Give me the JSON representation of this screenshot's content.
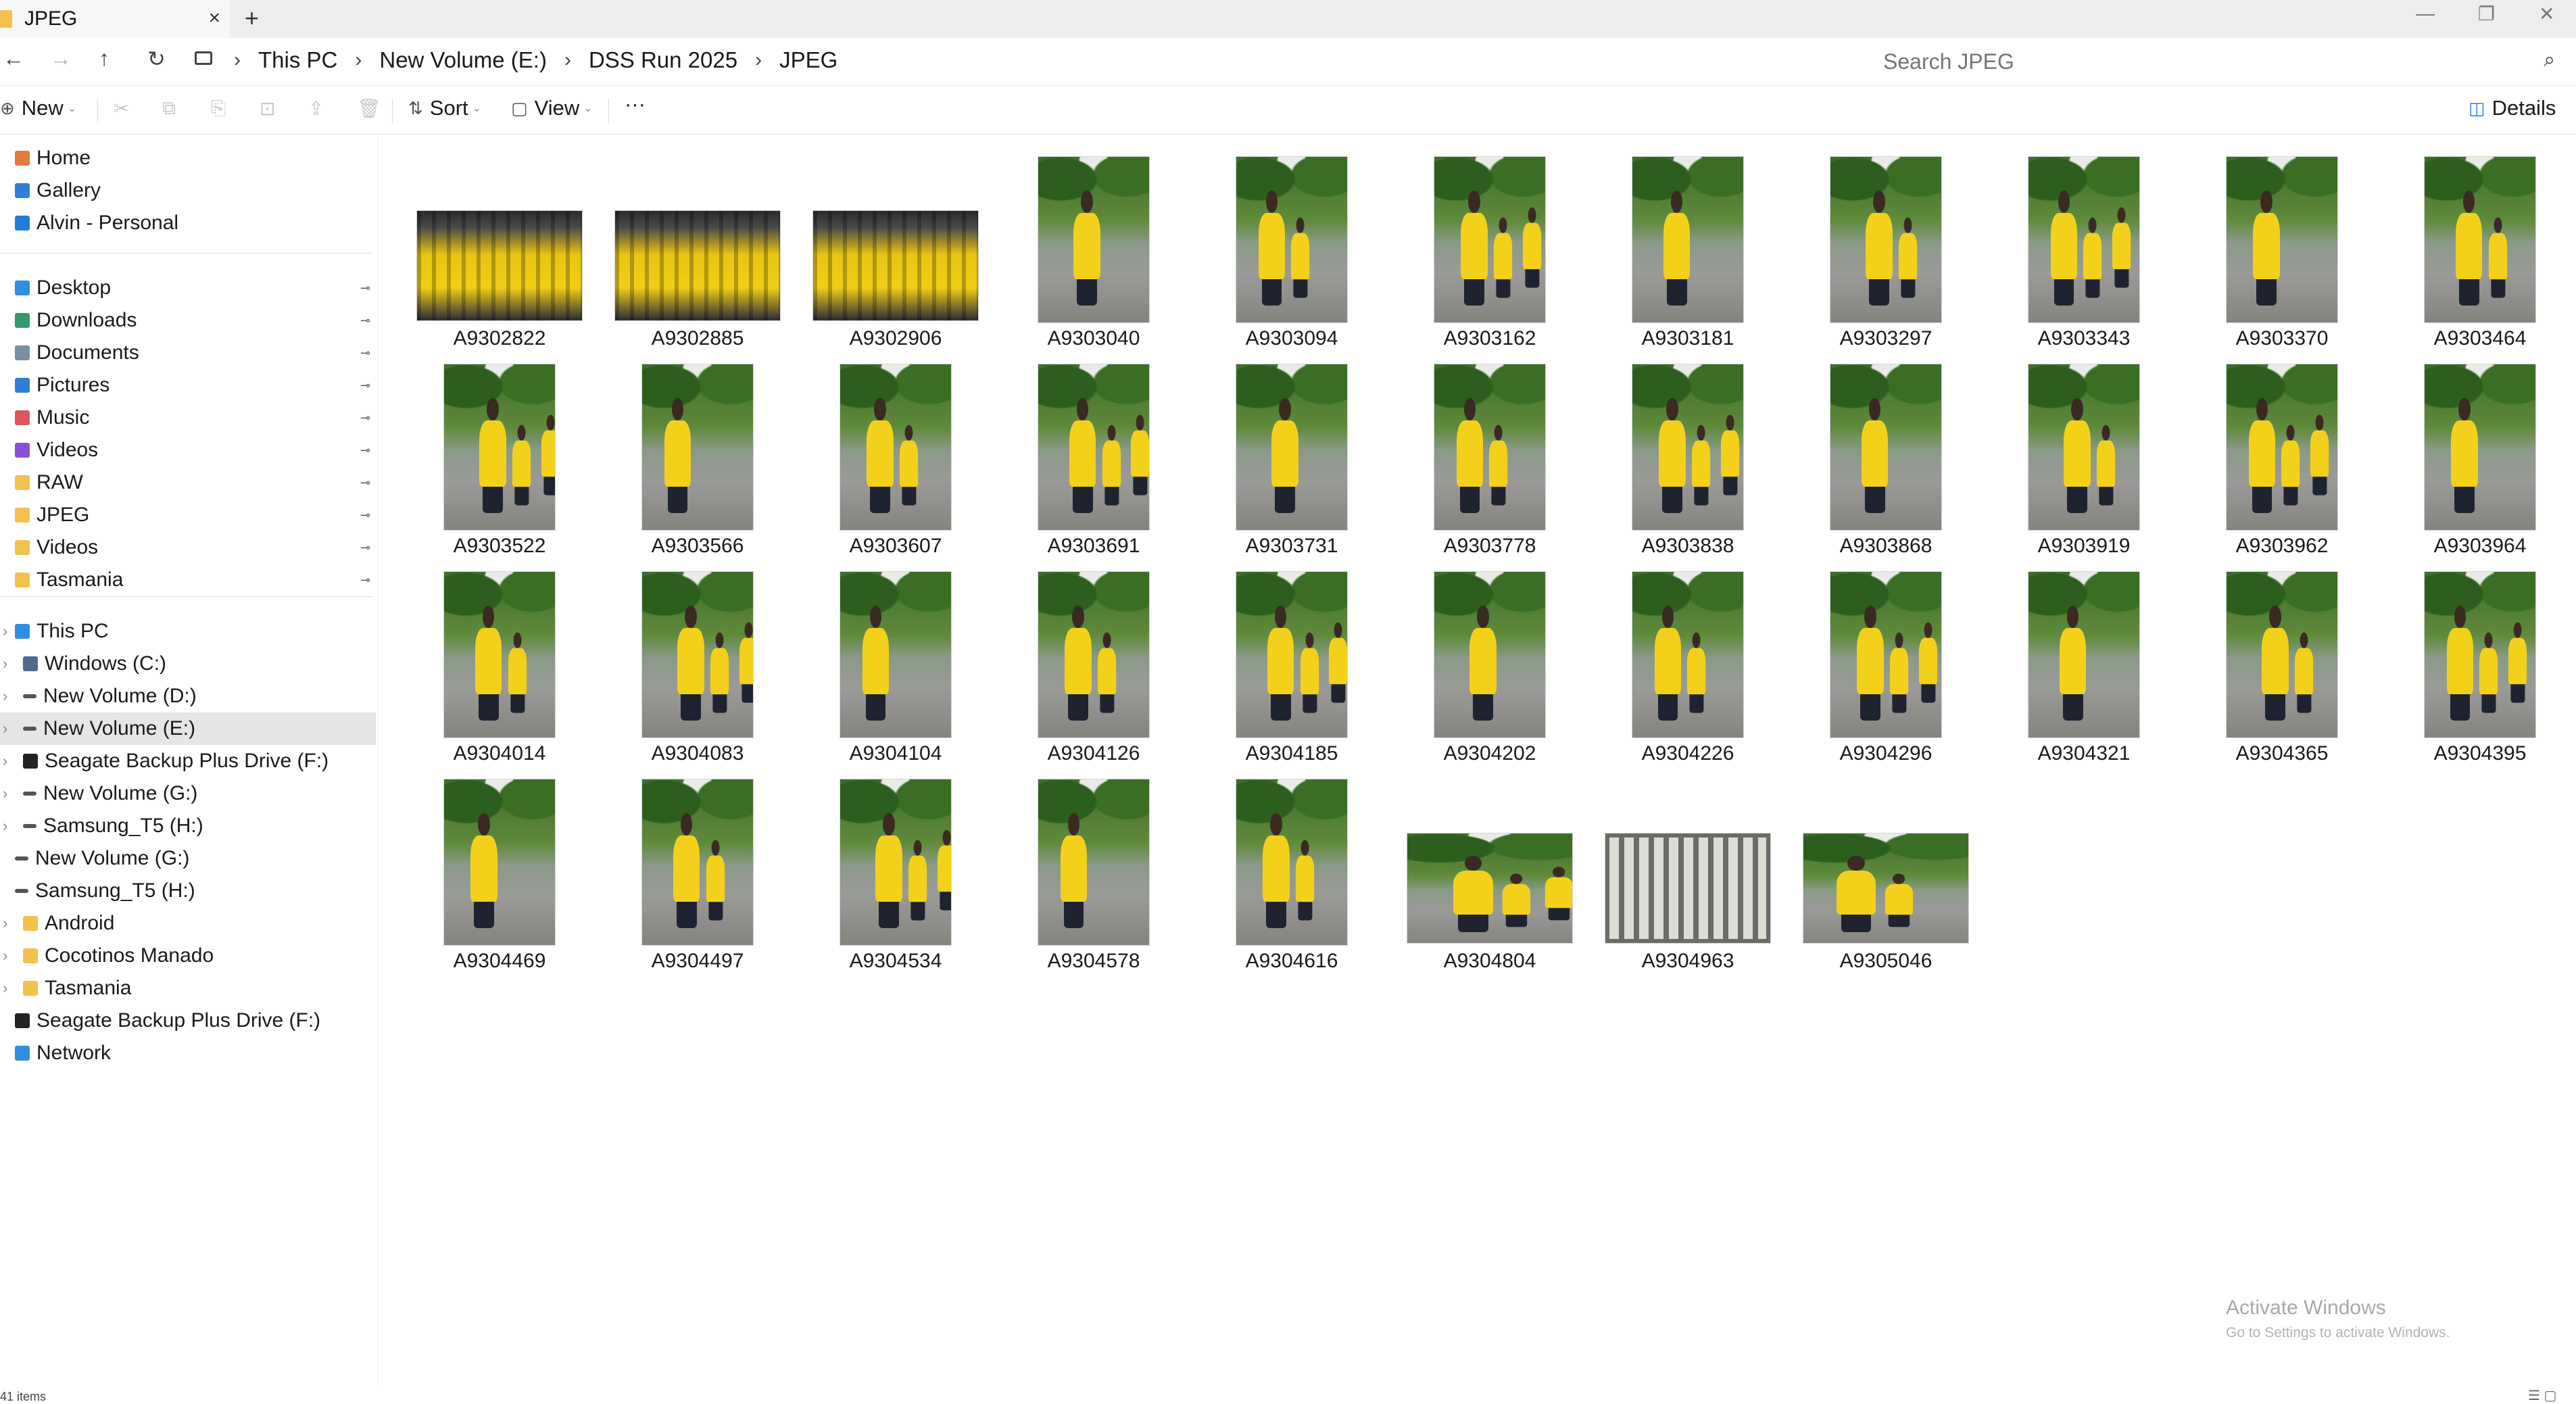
{
  "window": {
    "tab_title": "JPEG",
    "tab_close": "×",
    "new_tab": "+",
    "minimize": "—",
    "restore": "❐",
    "close": "✕"
  },
  "nav_buttons": {
    "back": "←",
    "forward": "→",
    "up": "↑",
    "refresh": "↻"
  },
  "breadcrumb": {
    "items": [
      "This PC",
      "New Volume (E:)",
      "DSS Run 2025",
      "JPEG"
    ],
    "separator": "›"
  },
  "search": {
    "placeholder": "Search JPEG",
    "icon": "⌕"
  },
  "toolbar": {
    "new_label": "New",
    "sort_label": "Sort",
    "view_label": "View",
    "more_label": "···",
    "details_label": "Details",
    "ghost_icons": [
      "✂",
      "⧉",
      "⎘",
      "⊡",
      "⇪",
      "🗑"
    ]
  },
  "sidebar": {
    "quick": [
      {
        "label": "Home",
        "color": "#e07b39"
      },
      {
        "label": "Gallery",
        "color": "#2f7fd8"
      },
      {
        "label": "Alvin - Personal",
        "color": "#1f7fd8"
      }
    ],
    "pinned": [
      {
        "label": "Desktop",
        "color": "#2f8fe0"
      },
      {
        "label": "Downloads",
        "color": "#2e9a6d"
      },
      {
        "label": "Documents",
        "color": "#7a8ea5"
      },
      {
        "label": "Pictures",
        "color": "#2f7fd8"
      },
      {
        "label": "Music",
        "color": "#e0575b"
      },
      {
        "label": "Videos",
        "color": "#8a4fd8"
      },
      {
        "label": "RAW",
        "color": "#f2c14e"
      },
      {
        "label": "JPEG",
        "color": "#f2c14e"
      },
      {
        "label": "Videos",
        "color": "#f2c14e"
      },
      {
        "label": "Tasmania",
        "color": "#f2c14e"
      }
    ],
    "pin_glyph": "⊸",
    "tree": [
      {
        "label": "This PC",
        "color": "#2f8fe0"
      },
      {
        "label": "Windows (C:)",
        "color": "#4d6b8c"
      },
      {
        "label": "New Volume (D:)",
        "color": "#555555"
      },
      {
        "label": "New Volume (E:)",
        "color": "#555555"
      },
      {
        "label": "Seagate Backup Plus Drive (F:)",
        "color": "#222222"
      },
      {
        "label": "New Volume (G:)",
        "color": "#555555"
      },
      {
        "label": "Samsung_T5 (H:)",
        "color": "#555555"
      },
      {
        "label": "New Volume (G:)",
        "color": "#555555"
      },
      {
        "label": "Samsung_T5 (H:)",
        "color": "#555555"
      },
      {
        "label": "Android",
        "color": "#f2c14e"
      },
      {
        "label": "Cocotinos Manado",
        "color": "#f2c14e"
      },
      {
        "label": "Tasmania",
        "color": "#f2c14e"
      },
      {
        "label": "Seagate Backup Plus Drive (F:)",
        "color": "#222222"
      },
      {
        "label": "Network",
        "color": "#2f8fe0"
      }
    ],
    "selected_label": "New Volume (E:)"
  },
  "files": [
    {
      "name": "A9302822",
      "kind": "crowd-landscape"
    },
    {
      "name": "A9302885",
      "kind": "crowd-landscape"
    },
    {
      "name": "A9302906",
      "kind": "crowd-landscape"
    },
    {
      "name": "A9303040",
      "kind": "portrait"
    },
    {
      "name": "A9303094",
      "kind": "portrait"
    },
    {
      "name": "A9303162",
      "kind": "portrait"
    },
    {
      "name": "A9303181",
      "kind": "portrait"
    },
    {
      "name": "A9303297",
      "kind": "portrait"
    },
    {
      "name": "A9303343",
      "kind": "portrait"
    },
    {
      "name": "A9303370",
      "kind": "portrait"
    },
    {
      "name": "A9303464",
      "kind": "portrait"
    },
    {
      "name": "A9303522",
      "kind": "portrait"
    },
    {
      "name": "A9303566",
      "kind": "portrait"
    },
    {
      "name": "A9303607",
      "kind": "portrait"
    },
    {
      "name": "A9303691",
      "kind": "portrait"
    },
    {
      "name": "A9303731",
      "kind": "portrait"
    },
    {
      "name": "A9303778",
      "kind": "portrait"
    },
    {
      "name": "A9303838",
      "kind": "portrait"
    },
    {
      "name": "A9303868",
      "kind": "portrait"
    },
    {
      "name": "A9303919",
      "kind": "portrait"
    },
    {
      "name": "A9303962",
      "kind": "portrait"
    },
    {
      "name": "A9303964",
      "kind": "portrait"
    },
    {
      "name": "A9304014",
      "kind": "portrait"
    },
    {
      "name": "A9304083",
      "kind": "portrait"
    },
    {
      "name": "A9304104",
      "kind": "portrait"
    },
    {
      "name": "A9304126",
      "kind": "portrait"
    },
    {
      "name": "A9304185",
      "kind": "portrait"
    },
    {
      "name": "A9304202",
      "kind": "portrait"
    },
    {
      "name": "A9304226",
      "kind": "portrait"
    },
    {
      "name": "A9304296",
      "kind": "portrait"
    },
    {
      "name": "A9304321",
      "kind": "portrait"
    },
    {
      "name": "A9304365",
      "kind": "portrait"
    },
    {
      "name": "A9304395",
      "kind": "portrait"
    },
    {
      "name": "A9304469",
      "kind": "portrait"
    },
    {
      "name": "A9304497",
      "kind": "portrait"
    },
    {
      "name": "A9304534",
      "kind": "portrait"
    },
    {
      "name": "A9304578",
      "kind": "portrait"
    },
    {
      "name": "A9304616",
      "kind": "portrait"
    },
    {
      "name": "A9304804",
      "kind": "landscape"
    },
    {
      "name": "A9304963",
      "kind": "grid-landscape"
    },
    {
      "name": "A9305046",
      "kind": "landscape"
    }
  ],
  "status": {
    "item_count": "41 items",
    "view_icons": "☰ ▢"
  },
  "watermark": {
    "line1": "Activate Windows",
    "line2": "Go to Settings to activate Windows."
  }
}
